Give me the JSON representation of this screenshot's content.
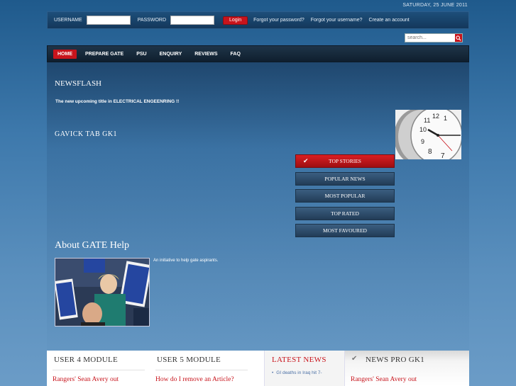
{
  "date": "SATURDAY, 25 JUNE 2011",
  "login": {
    "username_label": "USERNAME",
    "password_label": "PASSWORD",
    "login_button": "Login",
    "forgot_password": "Forgot your password?",
    "forgot_username": "Forgot your username?",
    "create_account": "Create an account"
  },
  "search": {
    "placeholder": "search..."
  },
  "nav": {
    "items": [
      {
        "label": "HOME"
      },
      {
        "label": "PREPARE GATE"
      },
      {
        "label": "PSU"
      },
      {
        "label": "ENQUIRY"
      },
      {
        "label": "REVIEWS"
      },
      {
        "label": "FAQ"
      }
    ]
  },
  "newsflash": {
    "title": "NEWSFLASH",
    "text": "The new upcoming title in ELECTRICAL ENGEENRING !!"
  },
  "gavick": {
    "title": "GAVICK TAB GK1"
  },
  "tabs": [
    {
      "label": "TOP STORIES"
    },
    {
      "label": "POPULAR NEWS"
    },
    {
      "label": "MOST POPULAR"
    },
    {
      "label": "TOP RATED"
    },
    {
      "label": "MOST FAVOURED"
    }
  ],
  "about": {
    "title": "About GATE Help",
    "text": "An initiative to help gate aspirants."
  },
  "bottom": {
    "col1": {
      "title": "USER 4 MODULE",
      "sub": "Rangers' Sean Avery out"
    },
    "col2": {
      "title": "USER 5 MODULE",
      "sub": "How do I remove an Article?"
    },
    "col3": {
      "title": "LATEST NEWS",
      "item1": "GI deaths in Iraq hit 7-"
    },
    "col4": {
      "title": "NEWS PRO GK1",
      "sub": "Rangers' Sean Avery out"
    }
  },
  "colors": {
    "accent": "#c8141c",
    "nav_bg": "#14283a",
    "bg_blue": "#3e79ac"
  },
  "icons": [
    "search-icon",
    "check-icon",
    "clock-image",
    "photo-image"
  ]
}
